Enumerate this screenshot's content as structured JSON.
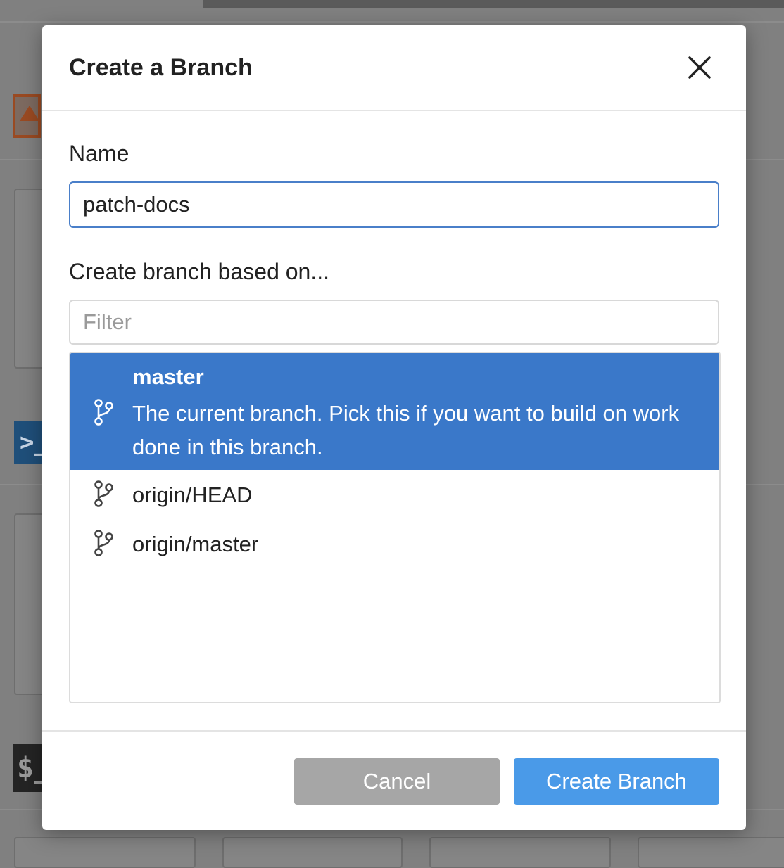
{
  "dialog": {
    "title": "Create a Branch",
    "name_label": "Name",
    "name_value": "patch-docs",
    "base_label": "Create branch based on...",
    "filter_placeholder": "Filter",
    "branches": [
      {
        "name": "master",
        "description": "The current branch. Pick this if you want to build on work done in this branch.",
        "selected": true,
        "icon": "git-branch-icon"
      },
      {
        "name": "origin/HEAD",
        "description": "",
        "selected": false,
        "icon": "git-branch-icon"
      },
      {
        "name": "origin/master",
        "description": "",
        "selected": false,
        "icon": "git-branch-icon"
      }
    ],
    "cancel_label": "Cancel",
    "create_label": "Create Branch",
    "close_icon": "close-icon"
  },
  "background": {
    "terminal_icon_text": ">_",
    "shell_icon_text": "$_"
  },
  "colors": {
    "selected_row": "#3a78c9",
    "primary_button": "#4a9ae8",
    "cancel_button": "#a6a6a6",
    "input_focus_border": "#4a7fc9",
    "overlay": "#808080"
  }
}
